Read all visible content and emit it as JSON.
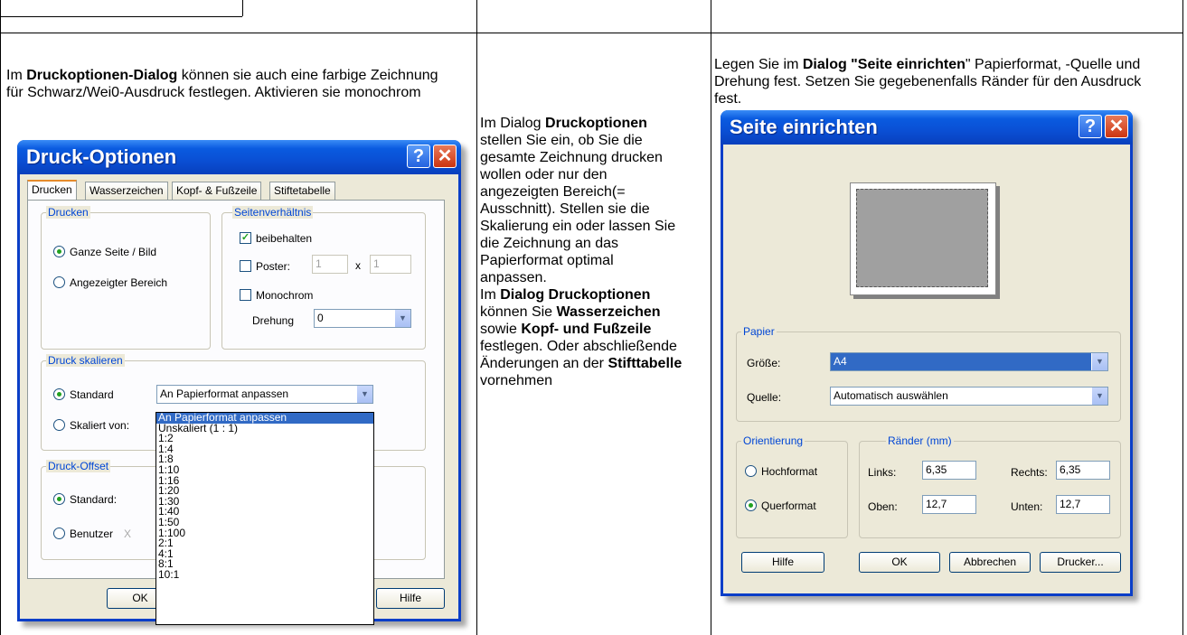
{
  "left_text": {
    "p1": "Im ",
    "b1": "Druckoptionen-Dialog",
    "p2": " können sie auch eine farbige Zeichnung für Schwarz/Wei0-Ausdruck festlegen. Aktivieren sie monochrom"
  },
  "mid_text": {
    "a1": "Im Dialog ",
    "b1": "Druckoptionen",
    "a2": " stellen Sie ein, ob Sie die gesamte Zeichnung drucken wollen oder nur den angezeigten Bereich(= Ausschnitt). Stellen sie die Skalierung ein oder lassen Sie die Zeichnung  an das Papierformat optimal anpassen.",
    "a3": "Im ",
    "b2": "Dialog Druckoptionen",
    "a4": " können Sie ",
    "b3": "Wasserzeichen",
    "a5": " sowie ",
    "b4": "Kopf- und Fußzeile",
    "a6": " festlegen. Oder abschließende Änderungen an der ",
    "b5": "Stifttabelle",
    "a7": " vornehmen"
  },
  "right_text": {
    "p1": "Legen Sie im ",
    "b1": "Dialog \"Seite einrichten",
    "p2": "\" Papierformat, -Quelle und Drehung fest. Setzen Sie gegebenenfalls Ränder für den Ausdruck fest."
  },
  "print_dialog": {
    "title": "Druck-Optionen",
    "help_glyph": "?",
    "close_glyph": "✕",
    "tabs": [
      "Drucken",
      "Wasserzeichen",
      "Kopf- & Fußzeile",
      "Stiftetabelle"
    ],
    "group_print": "Drucken",
    "radio_full": "Ganze Seite / Bild",
    "radio_shown": "Angezeigter Bereich",
    "group_ratio": "Seitenverhältnis",
    "chk_keep": "beibehalten",
    "chk_poster": "Poster:",
    "poster_x": "1",
    "poster_times": "x",
    "poster_y": "1",
    "chk_mono": "Monochrom",
    "rotation_label": "Drehung",
    "rotation_value": "0",
    "group_scale": "Druck skalieren",
    "radio_standard": "Standard",
    "scale_value": "An Papierformat anpassen",
    "radio_scaled": "Skaliert von:",
    "scale_options": [
      "An Papierformat anpassen",
      "Unskaliert (1 : 1)",
      "1:2",
      "1:4",
      "1:8",
      "1:10",
      "1:16",
      "1:20",
      "1:30",
      "1:40",
      "1:50",
      "1:100",
      "2:1",
      "4:1",
      "8:1",
      "10:1"
    ],
    "group_offset": "Druck-Offset",
    "radio_offset_std": "Standard:",
    "radio_offset_user": "Benutzer",
    "offset_x": "X",
    "ok": "OK",
    "help": "Hilfe"
  },
  "page_dialog": {
    "title": "Seite einrichten",
    "help_glyph": "?",
    "close_glyph": "✕",
    "group_paper": "Papier",
    "size_label": "Größe:",
    "size_value": "A4",
    "source_label": "Quelle:",
    "source_value": "Automatisch auswählen",
    "group_orient": "Orientierung",
    "radio_portrait": "Hochformat",
    "radio_landscape": "Querformat",
    "group_margins": "Ränder (mm)",
    "left_label": "Links:",
    "left_value": "6,35",
    "right_label": "Rechts:",
    "right_value": "6,35",
    "top_label": "Oben:",
    "top_value": "12,7",
    "bottom_label": "Unten:",
    "bottom_value": "12,7",
    "btn_help": "Hilfe",
    "btn_ok": "OK",
    "btn_cancel": "Abbrechen",
    "btn_printer": "Drucker..."
  }
}
